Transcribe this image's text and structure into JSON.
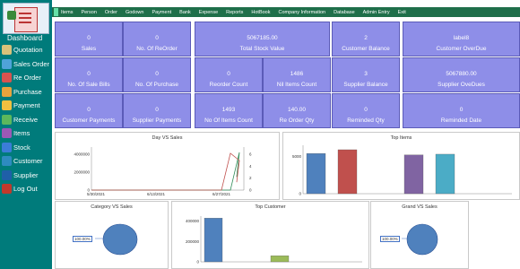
{
  "sidebar": {
    "title": "Dashboard",
    "items": [
      {
        "label": "Quotation",
        "icon": "quotation-icon",
        "color": "#d9c27a"
      },
      {
        "label": "Sales Order",
        "icon": "sales-order-icon",
        "color": "#4fa3d9"
      },
      {
        "label": "Re Order",
        "icon": "re-order-icon",
        "color": "#d9534f"
      },
      {
        "label": "Purchase",
        "icon": "purchase-icon",
        "color": "#e8a33d"
      },
      {
        "label": "Payment",
        "icon": "payment-icon",
        "color": "#f0c040"
      },
      {
        "label": "Receive",
        "icon": "receive-icon",
        "color": "#5cb85c"
      },
      {
        "label": "Items",
        "icon": "items-icon",
        "color": "#9b59b6"
      },
      {
        "label": "Stock",
        "icon": "stock-icon",
        "color": "#3b7dd8"
      },
      {
        "label": "Customer",
        "icon": "customer-icon",
        "color": "#2e8bc0"
      },
      {
        "label": "Supplier",
        "icon": "supplier-icon",
        "color": "#1f5fa8"
      },
      {
        "label": "Log Out",
        "icon": "logout-icon",
        "color": "#c0392b"
      }
    ]
  },
  "menu": [
    "Items",
    "Person",
    "Order",
    "Godown",
    "Payment",
    "Bank",
    "Expense",
    "Reports",
    "HotBook",
    "Company Information",
    "Database",
    "Admin Entry",
    "Exit"
  ],
  "tiles": [
    {
      "value": "0",
      "label": "Sales"
    },
    {
      "value": "0",
      "label": "No. Of ReOrder"
    },
    {
      "value": "5067185.00",
      "label": "Total Stock Value"
    },
    {
      "value": "2",
      "label": "Customer Balance"
    },
    {
      "value": "label8",
      "label": "Customer OverDue"
    },
    {
      "value": "0",
      "label": "No. Of Sale Bills"
    },
    {
      "value": "0",
      "label": "No. Of Purchase"
    },
    {
      "value": "0",
      "label": "Reorder Count"
    },
    {
      "value": "1486",
      "label": "Nil Items Count"
    },
    {
      "value": "3",
      "label": "Supplier Balance"
    },
    {
      "value": "5067880.00",
      "label": "Supplier OveDues"
    },
    {
      "value": "0",
      "label": "Customer Payments"
    },
    {
      "value": "0",
      "label": "Supplier Payments"
    },
    {
      "value": "1493",
      "label": "No Of Items Count"
    },
    {
      "value": "140.00",
      "label": "Re Order Qty"
    },
    {
      "value": "0",
      "label": "Reminded Qty"
    },
    {
      "value": "0",
      "label": "Reminded Date"
    }
  ],
  "charts": {
    "day_vs_sales": {
      "title": "Day VS Sales",
      "y_ticks": [
        "4000000",
        "2000000",
        "0"
      ],
      "y2_ticks": [
        "6",
        "4",
        "2",
        "0"
      ],
      "x_ticks": [
        "5/30/2021",
        "6/13/2021",
        "6/27/2021"
      ]
    },
    "top_items": {
      "title": "Top Items",
      "y_ticks": [
        "5000",
        "0"
      ]
    },
    "category_vs_sales": {
      "title": "Category VS Sales",
      "callout": "100.00%"
    },
    "top_customer": {
      "title": "Top Customer",
      "y_ticks": [
        "400000",
        "200000",
        "0"
      ]
    },
    "grand_vs_sales": {
      "title": "Grand VS Sales",
      "callout": "100.00%"
    }
  },
  "chart_data": [
    {
      "type": "line",
      "title": "Day VS Sales",
      "x": [
        "5/30/2021",
        "6/13/2021",
        "6/27/2021",
        "7/1/2021",
        "7/3/2021",
        "7/8/2021"
      ],
      "series": [
        {
          "color": "#2e8b57",
          "axis": "left",
          "values": [
            0,
            0,
            0,
            0,
            4300000,
            1500000
          ]
        },
        {
          "color": "#c0504d",
          "axis": "right",
          "values": [
            0,
            0,
            0,
            5.6,
            4.5,
            1.2
          ]
        }
      ],
      "ylim": [
        0,
        4500000
      ],
      "y2lim": [
        0,
        6
      ]
    },
    {
      "type": "bar",
      "title": "Top Items",
      "values": [
        5400,
        5900,
        null,
        5200,
        5300
      ],
      "colors": [
        "#4f81bd",
        "#c0504d",
        "",
        "#8064a2",
        "#4bacc6"
      ],
      "ylim": [
        0,
        6500
      ]
    },
    {
      "type": "pie",
      "title": "Category VS Sales",
      "values": [
        100
      ],
      "colors": [
        "#4f81bd"
      ]
    },
    {
      "type": "bar",
      "title": "Top Customer",
      "values": [
        430000,
        60000
      ],
      "colors": [
        "#4f81bd",
        "#9bbb59"
      ],
      "ylim": [
        0,
        450000
      ]
    },
    {
      "type": "pie",
      "title": "Grand VS Sales",
      "values": [
        100
      ],
      "colors": [
        "#4f81bd"
      ]
    }
  ]
}
